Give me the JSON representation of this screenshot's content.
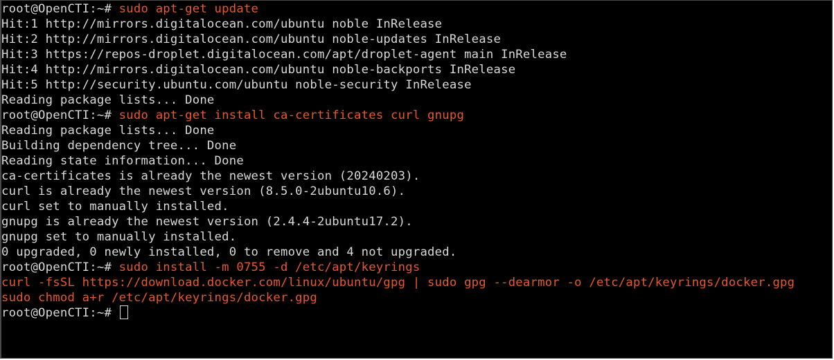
{
  "terminal": {
    "prompt": "root@OpenCTI:~# ",
    "colors": {
      "background": "#000000",
      "text": "#d9d9d9",
      "command": "#e8582c"
    },
    "lines": [
      {
        "prompt": "root@OpenCTI:~# ",
        "cmd": "sudo apt-get update"
      },
      {
        "text": "Hit:1 http://mirrors.digitalocean.com/ubuntu noble InRelease"
      },
      {
        "text": "Hit:2 http://mirrors.digitalocean.com/ubuntu noble-updates InRelease"
      },
      {
        "text": "Hit:3 https://repos-droplet.digitalocean.com/apt/droplet-agent main InRelease"
      },
      {
        "text": "Hit:4 http://mirrors.digitalocean.com/ubuntu noble-backports InRelease"
      },
      {
        "text": "Hit:5 http://security.ubuntu.com/ubuntu noble-security InRelease"
      },
      {
        "text": "Reading package lists... Done"
      },
      {
        "prompt": "root@OpenCTI:~# ",
        "cmd": "sudo apt-get install ca-certificates curl gnupg"
      },
      {
        "text": "Reading package lists... Done"
      },
      {
        "text": "Building dependency tree... Done"
      },
      {
        "text": "Reading state information... Done"
      },
      {
        "text": "ca-certificates is already the newest version (20240203)."
      },
      {
        "text": "curl is already the newest version (8.5.0-2ubuntu10.6)."
      },
      {
        "text": "curl set to manually installed."
      },
      {
        "text": "gnupg is already the newest version (2.4.4-2ubuntu17.2)."
      },
      {
        "text": "gnupg set to manually installed."
      },
      {
        "text": "0 upgraded, 0 newly installed, 0 to remove and 4 not upgraded."
      },
      {
        "prompt": "root@OpenCTI:~# ",
        "cmd": "sudo install -m 0755 -d /etc/apt/keyrings"
      },
      {
        "cmd": "curl -fsSL https://download.docker.com/linux/ubuntu/gpg | sudo gpg --dearmor -o /etc/apt/keyrings/docker.gpg"
      },
      {
        "cmd": "sudo chmod a+r /etc/apt/keyrings/docker.gpg"
      },
      {
        "prompt": "root@OpenCTI:~# ",
        "cursor": true
      }
    ]
  }
}
